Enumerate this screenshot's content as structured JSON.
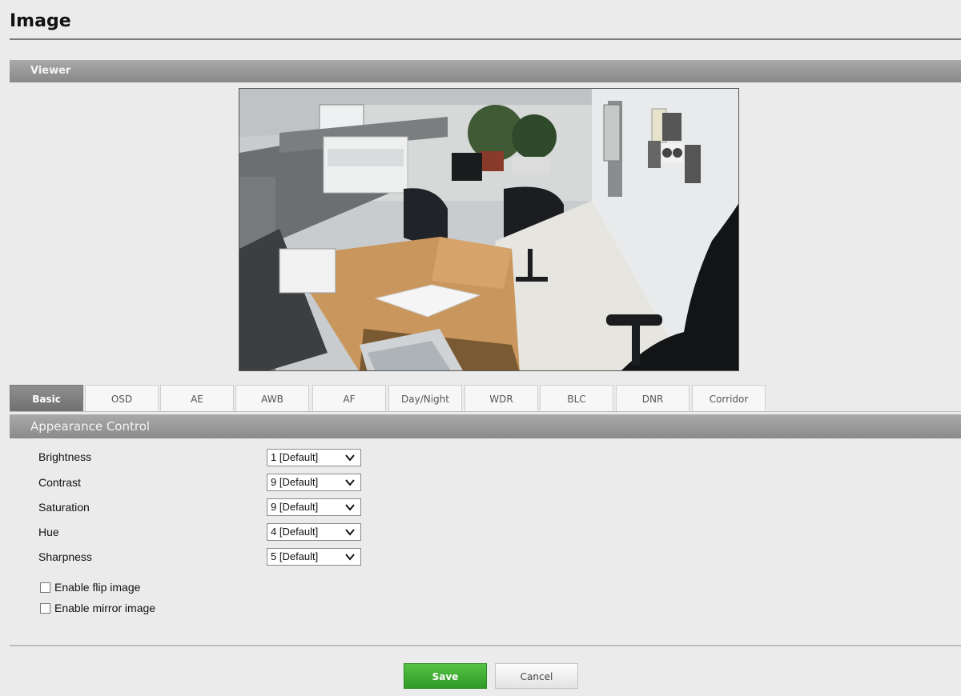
{
  "page": {
    "title": "Image"
  },
  "viewer": {
    "section_label": "Viewer",
    "image_desc": "camera-live-view"
  },
  "tabs": [
    {
      "label": "Basic",
      "active": true
    },
    {
      "label": "OSD"
    },
    {
      "label": "AE"
    },
    {
      "label": "AWB"
    },
    {
      "label": "AF"
    },
    {
      "label": "Day/Night"
    },
    {
      "label": "WDR"
    },
    {
      "label": "BLC"
    },
    {
      "label": "DNR"
    },
    {
      "label": "Corridor"
    }
  ],
  "appearance": {
    "section_label": "Appearance Control",
    "fields": [
      {
        "label": "Brightness",
        "value": "1 [Default]"
      },
      {
        "label": "Contrast",
        "value": "9 [Default]"
      },
      {
        "label": "Saturation",
        "value": "9 [Default]"
      },
      {
        "label": "Hue",
        "value": "4 [Default]"
      },
      {
        "label": "Sharpness",
        "value": "5 [Default]"
      }
    ],
    "checkboxes": [
      {
        "label": "Enable flip image",
        "checked": false
      },
      {
        "label": "Enable mirror image",
        "checked": false
      }
    ]
  },
  "buttons": {
    "save_label": "Save",
    "cancel_label": "Cancel"
  },
  "colors": {
    "save_green": "#3aa82f",
    "section_gray": "#999999",
    "active_tab": "#7f7f7f"
  }
}
